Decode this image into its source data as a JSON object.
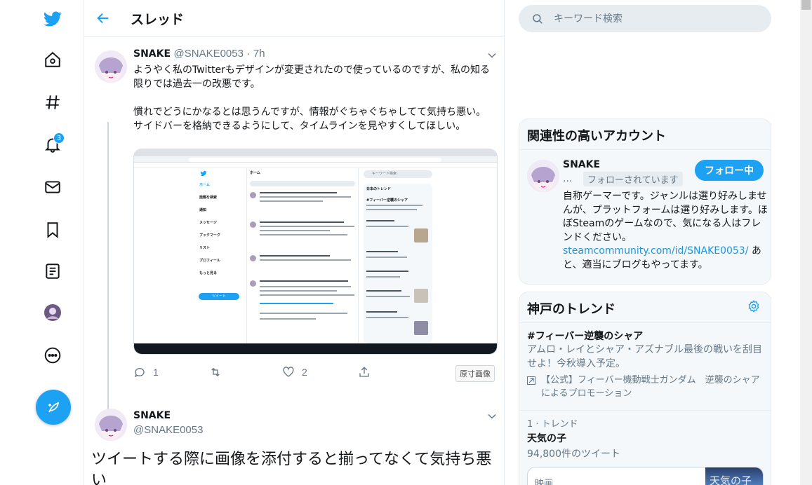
{
  "colors": {
    "accent": "#1da1f2",
    "text": "#14171a",
    "muted": "#657786",
    "border": "#e6ecf0",
    "panel_bg": "#f5f8fa"
  },
  "nav": {
    "icons": [
      "twitter-bird-icon",
      "home-icon",
      "explore-hashtag-icon",
      "notifications-bell-icon",
      "messages-envelope-icon",
      "bookmarks-icon",
      "lists-icon",
      "profile-avatar-icon",
      "more-icon"
    ],
    "notifications_badge": "3",
    "compose_icon": "compose-feather-icon"
  },
  "header": {
    "title": "スレッド"
  },
  "tweet1": {
    "name": "SNAKE",
    "handle": "@SNAKE0053",
    "separator": "·",
    "time": "7h",
    "body": "ようやく私のTwitterもデザインが変更されたので使っているのですが、私の知る限りでは過去一の改悪です。\n\n慣れでどうにかなるとは思うんですが、情報がぐちゃぐちゃしてて気持ち悪い。\nサイドバーを格納できるようにして、タイムラインを見やすくしてほしい。",
    "replies": "1",
    "likes": "2",
    "original_image": "原寸画像",
    "media": {
      "mini_sidebar": [
        "ホーム",
        "話題を検索",
        "通知",
        "メッセージ",
        "ブックマーク",
        "リスト",
        "プロフィール",
        "もっと見る"
      ],
      "mini_tweet_button": "ツイート",
      "mini_column_title": "ホーム",
      "mini_search": "キーワード検索",
      "mini_trends_title": "日本のトレンド",
      "mini_trend_1": "#フィーバー逆襲のシャア"
    }
  },
  "tweet2": {
    "name": "SNAKE",
    "handle": "@SNAKE0053",
    "body": "ツイートする際に画像を添付すると揃ってなくて気持ち悪い"
  },
  "search": {
    "placeholder": "キーワード検索"
  },
  "related": {
    "title": "関連性の高いアカウント",
    "name": "SNAKE",
    "dots": "...",
    "follows_you": "フォローされています",
    "follow_button": "フォロー中",
    "bio_before": "自称ゲーマーです。ジャンルは選り好みしませんが、プラットフォームは選り好みします。ほぼSteamのゲームなので、気になる人はフレンドください。",
    "bio_link": "steamcommunity.com/id/SNAKE0053/",
    "bio_after": " あと、適当にブログもやってます。"
  },
  "trends": {
    "title": "神戸のトレンド",
    "items": [
      {
        "name": "#フィーバー逆襲のシャア",
        "desc": "アムロ・レイとシャア・アズナブル最後の戦いを刮目せよ！今秋導入予定。",
        "promo": "【公式】フィーバー機動戦士ガンダム　逆襲のシャアによるプロモーション"
      },
      {
        "meta": "1 · トレンド",
        "name": "天気の子",
        "count": "94,800件のツイート",
        "card_label": "映画",
        "card_image_text": "天気の子"
      }
    ]
  }
}
